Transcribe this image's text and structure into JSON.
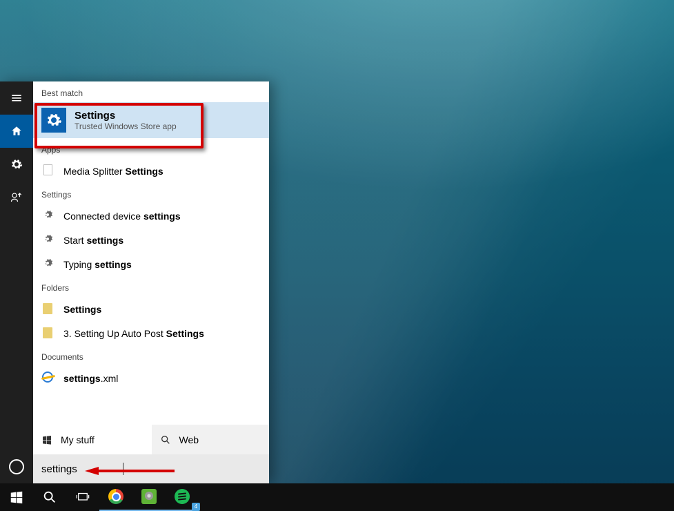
{
  "sections": {
    "best_match": "Best match",
    "apps": "Apps",
    "settings": "Settings",
    "folders": "Folders",
    "documents": "Documents"
  },
  "best_match": {
    "title": "Settings",
    "subtitle": "Trusted Windows Store app"
  },
  "apps": [
    {
      "prefix": "Media Splitter ",
      "bold": "Settings",
      "suffix": ""
    }
  ],
  "settings_list": [
    {
      "prefix": "Connected device ",
      "bold": "settings",
      "suffix": ""
    },
    {
      "prefix": "Start ",
      "bold": "settings",
      "suffix": ""
    },
    {
      "prefix": "Typing ",
      "bold": "settings",
      "suffix": ""
    }
  ],
  "folders_list": [
    {
      "prefix": "",
      "bold": "Settings",
      "suffix": ""
    },
    {
      "prefix": "3. Setting Up Auto Post ",
      "bold": "Settings",
      "suffix": ""
    }
  ],
  "documents_list": [
    {
      "prefix": "",
      "bold": "settings",
      "suffix": ".xml"
    }
  ],
  "tabs": {
    "mystuff": "My stuff",
    "web": "Web"
  },
  "search_value": "settings",
  "spotify_badge": "4"
}
